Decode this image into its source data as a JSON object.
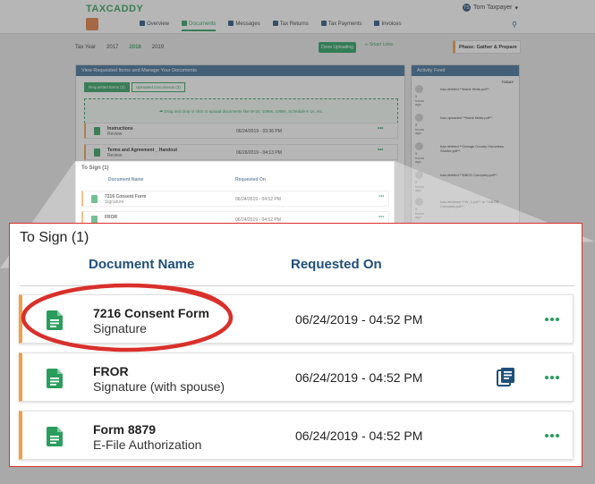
{
  "app": {
    "logo": "TAXCADDY",
    "user_initials": "TS",
    "user_name": "Tom Taxpayer",
    "nav": [
      {
        "label": "Overview",
        "active": false
      },
      {
        "label": "Documents",
        "active": true
      },
      {
        "label": "Messages",
        "active": false
      },
      {
        "label": "Tax Returns",
        "active": false
      },
      {
        "label": "Tax Payments",
        "active": false
      },
      {
        "label": "Invoices",
        "active": false
      }
    ],
    "tax_year_label": "Tax Year",
    "years": [
      "2017",
      "2018",
      "2019"
    ],
    "selected_year": "2018",
    "done_uploading": "Done Uploading",
    "smart_links": "Smart Links",
    "phase": "Phase: Gather & Prepare"
  },
  "main_panel": {
    "title": "View Requested Items and Manage Your Documents",
    "tabs": [
      "Requested Items (3)",
      "Uploaded Documents (3)"
    ],
    "dropzone": "Drag and drop or click to upload documents like W-2s, 1099s, 1098s, Schedule K-1s, etc.",
    "rows": [
      {
        "name": "Instructions",
        "sub": "Review",
        "date": "06/24/2019 - 03:36 PM"
      },
      {
        "name": "Terms and Agreement _ Handout",
        "sub": "Review",
        "date": "06/26/2019 - 04:13 PM"
      }
    ]
  },
  "mini_sign": {
    "title": "To Sign (1)",
    "col_doc": "Document Name",
    "col_req": "Requested On",
    "rows": [
      {
        "name": "7216 Consent Form",
        "sub": "Signature",
        "date": "06/24/2019 - 04:52 PM"
      },
      {
        "name": "FROR",
        "sub": "",
        "date": "06/24/2019 - 04:52 PM"
      }
    ]
  },
  "activity_feed": {
    "title": "Activity Feed",
    "today": "TODAY",
    "items": [
      {
        "time": "5 hours ago",
        "text": "has deleted **blank fields.pdf**."
      },
      {
        "time": "5 hours ago",
        "text": "has uploaded **blank fields.pdf**."
      },
      {
        "time": "5 hours ago",
        "text": "has deleted **Orange County Homeless Shelter.pdf**."
      },
      {
        "time": "5 hours ago",
        "text": "has deleted **ABCD Company.pdf**."
      },
      {
        "time": "5 hours ago",
        "text": "has renamed **W_2.pdf** to **ABCD Company.pdf**."
      }
    ]
  },
  "to_sign": {
    "title": "To Sign (1)",
    "col_doc": "Document Name",
    "col_req": "Requested On",
    "rows": [
      {
        "name": "7216 Consent Form",
        "sub": "Signature",
        "date": "06/24/2019 - 04:52 PM",
        "has_view": false
      },
      {
        "name": "FROR",
        "sub": "Signature (with spouse)",
        "date": "06/24/2019 - 04:52 PM",
        "has_view": true
      },
      {
        "name": "Form 8879",
        "sub": "E-File Authorization",
        "date": "06/24/2019 - 04:52 PM",
        "has_view": false
      }
    ]
  },
  "colors": {
    "green": "#2a9d5c",
    "navy": "#1f4f7a",
    "orange": "#f0a04b",
    "callout_red": "#d9302b"
  }
}
